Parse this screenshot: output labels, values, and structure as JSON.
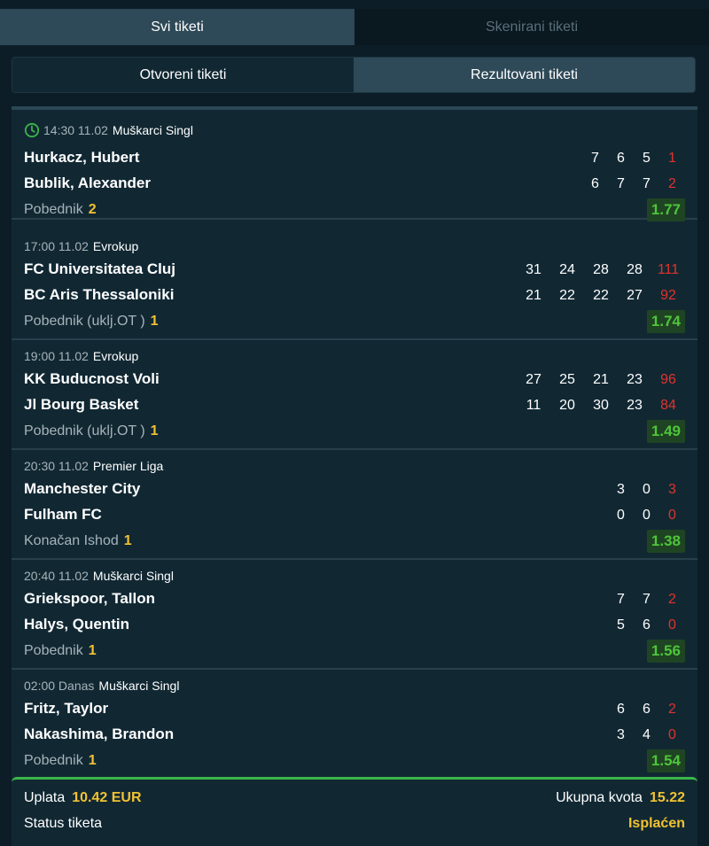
{
  "tabs_main": [
    {
      "label": "Svi tiketi",
      "active": true
    },
    {
      "label": "Skenirani tiketi",
      "active": false
    }
  ],
  "tabs_sub": [
    {
      "label": "Otvoreni tiketi",
      "active": false
    },
    {
      "label": "Rezultovani tiketi",
      "active": true
    }
  ],
  "matches": [
    {
      "time": "14:30 11.02",
      "competition": "Muškarci Singl",
      "has_clock_icon": true,
      "home": "Hurkacz, Hubert",
      "away": "Bublik, Alexander",
      "home_scores": [
        "7",
        "6",
        "5"
      ],
      "home_final": "1",
      "away_scores": [
        "6",
        "7",
        "7"
      ],
      "away_final": "2",
      "market": "Pobednik",
      "selection": "2",
      "odd": "1.77"
    },
    {
      "time": "17:00 11.02",
      "competition": "Evrokup",
      "home": "FC Universitatea Cluj",
      "away": "BC Aris Thessaloniki",
      "home_scores": [
        "31",
        "24",
        "28",
        "28"
      ],
      "home_final": "111",
      "away_scores": [
        "21",
        "22",
        "22",
        "27"
      ],
      "away_final": "92",
      "market": "Pobednik (uklj.OT )",
      "selection": "1",
      "odd": "1.74"
    },
    {
      "time": "19:00 11.02",
      "competition": "Evrokup",
      "home": "KK Buducnost Voli",
      "away": "Jl Bourg Basket",
      "home_scores": [
        "27",
        "25",
        "21",
        "23"
      ],
      "home_final": "96",
      "away_scores": [
        "11",
        "20",
        "30",
        "23"
      ],
      "away_final": "84",
      "market": "Pobednik (uklj.OT )",
      "selection": "1",
      "odd": "1.49"
    },
    {
      "time": "20:30 11.02",
      "competition": "Premier Liga",
      "home": "Manchester City",
      "away": "Fulham FC",
      "home_scores": [
        "3",
        "0"
      ],
      "home_final": "3",
      "away_scores": [
        "0",
        "0"
      ],
      "away_final": "0",
      "market": "Konačan Ishod",
      "selection": "1",
      "odd": "1.38"
    },
    {
      "time": "20:40 11.02",
      "competition": "Muškarci Singl",
      "home": "Griekspoor, Tallon",
      "away": "Halys, Quentin",
      "home_scores": [
        "7",
        "7"
      ],
      "home_final": "2",
      "away_scores": [
        "5",
        "6"
      ],
      "away_final": "0",
      "market": "Pobednik",
      "selection": "1",
      "odd": "1.56"
    },
    {
      "time": "02:00 Danas",
      "competition": "Muškarci Singl",
      "home": "Fritz, Taylor",
      "away": "Nakashima, Brandon",
      "home_scores": [
        "6",
        "6"
      ],
      "home_final": "2",
      "away_scores": [
        "3",
        "4"
      ],
      "away_final": "0",
      "market": "Pobednik",
      "selection": "1",
      "odd": "1.54"
    }
  ],
  "summary": {
    "stake_label": "Uplata",
    "stake_value": "10.42 EUR",
    "total_odds_label": "Ukupna kvota",
    "total_odds_value": "15.22",
    "status_label": "Status tiketa",
    "status_value": "Isplaćen"
  },
  "colors": {
    "background": "#0c1d27",
    "panel": "#112833",
    "accent_yellow": "#f1c232",
    "odd_green": "#4ec53a",
    "score_red": "#e0332c",
    "divider_green": "#3bb54a"
  }
}
